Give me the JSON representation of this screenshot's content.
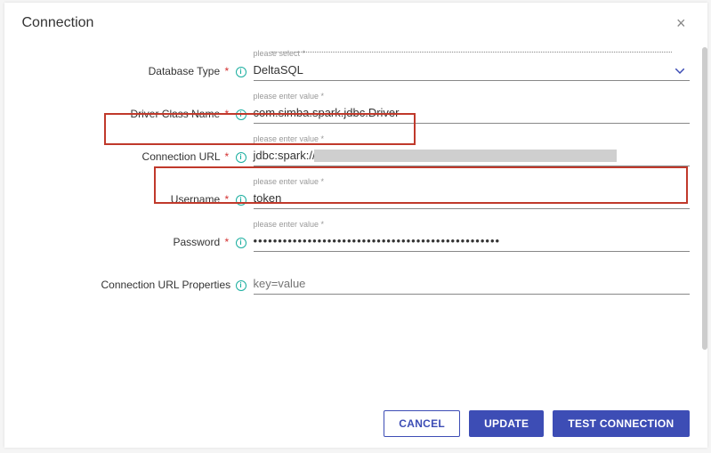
{
  "modal": {
    "title": "Connection"
  },
  "hints": {
    "selectReq": "please select *",
    "enterReq": "please enter value *",
    "enter": "please enter value"
  },
  "fields": {
    "databaseType": {
      "label": "Database Type",
      "value": "DeltaSQL"
    },
    "driverClassName": {
      "label": "Driver Class Name",
      "value": "com.simba.spark.jdbc.Driver"
    },
    "connectionUrl": {
      "label": "Connection URL",
      "valuePrefix": "jdbc:spark://"
    },
    "username": {
      "label": "Username",
      "value": "token"
    },
    "password": {
      "label": "Password",
      "value": "••••••••••••••••••••••••••••••••••••••••••••••••••"
    },
    "urlProperties": {
      "label": "Connection URL Properties",
      "placeholder": "key=value"
    }
  },
  "buttons": {
    "cancel": "CANCEL",
    "update": "UPDATE",
    "test": "TEST CONNECTION"
  }
}
